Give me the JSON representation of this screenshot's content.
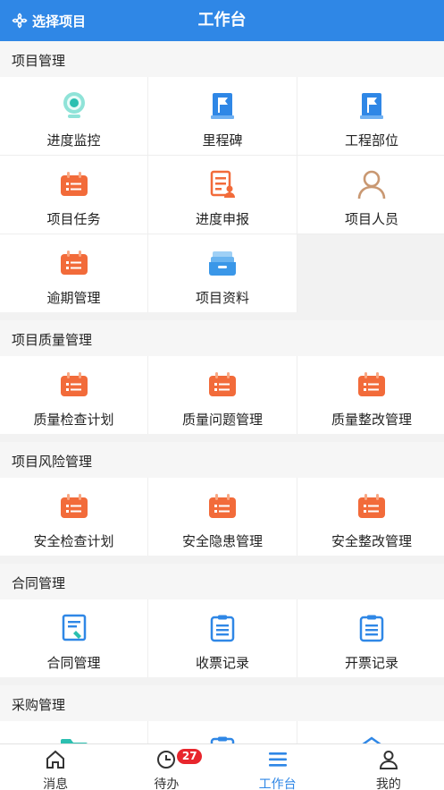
{
  "header": {
    "select_project": "选择项目",
    "title": "工作台"
  },
  "sections": [
    {
      "title": "项目管理",
      "items": [
        {
          "label": "进度监控",
          "icon": "webcam-icon"
        },
        {
          "label": "里程碑",
          "icon": "flag-icon"
        },
        {
          "label": "工程部位",
          "icon": "flag-icon"
        },
        {
          "label": "项目任务",
          "icon": "calendar-icon"
        },
        {
          "label": "进度申报",
          "icon": "report-icon"
        },
        {
          "label": "项目人员",
          "icon": "person-icon"
        },
        {
          "label": "逾期管理",
          "icon": "calendar-icon"
        },
        {
          "label": "项目资料",
          "icon": "tray-icon"
        }
      ]
    },
    {
      "title": "项目质量管理",
      "items": [
        {
          "label": "质量检查计划",
          "icon": "calendar-icon"
        },
        {
          "label": "质量问题管理",
          "icon": "calendar-icon"
        },
        {
          "label": "质量整改管理",
          "icon": "calendar-icon"
        }
      ]
    },
    {
      "title": "项目风险管理",
      "items": [
        {
          "label": "安全检查计划",
          "icon": "calendar-icon"
        },
        {
          "label": "安全隐患管理",
          "icon": "calendar-icon"
        },
        {
          "label": "安全整改管理",
          "icon": "calendar-icon"
        }
      ]
    },
    {
      "title": "合同管理",
      "items": [
        {
          "label": "合同管理",
          "icon": "contract-icon"
        },
        {
          "label": "收票记录",
          "icon": "clipboard-icon"
        },
        {
          "label": "开票记录",
          "icon": "clipboard-icon"
        }
      ]
    },
    {
      "title": "采购管理",
      "items": [
        {
          "label": "",
          "icon": "folder-icon"
        },
        {
          "label": "",
          "icon": "checklist-icon"
        },
        {
          "label": "",
          "icon": "warehouse-icon"
        }
      ]
    }
  ],
  "tabbar": [
    {
      "label": "消息",
      "icon": "home-icon"
    },
    {
      "label": "待办",
      "icon": "clock-icon",
      "badge": "27"
    },
    {
      "label": "工作台",
      "icon": "menu-icon",
      "active": true
    },
    {
      "label": "我的",
      "icon": "user-icon"
    }
  ],
  "colors": {
    "primary": "#2f87e6",
    "orange": "#f26b3a",
    "teal": "#2bbfb0",
    "badge": "#e8262d"
  }
}
